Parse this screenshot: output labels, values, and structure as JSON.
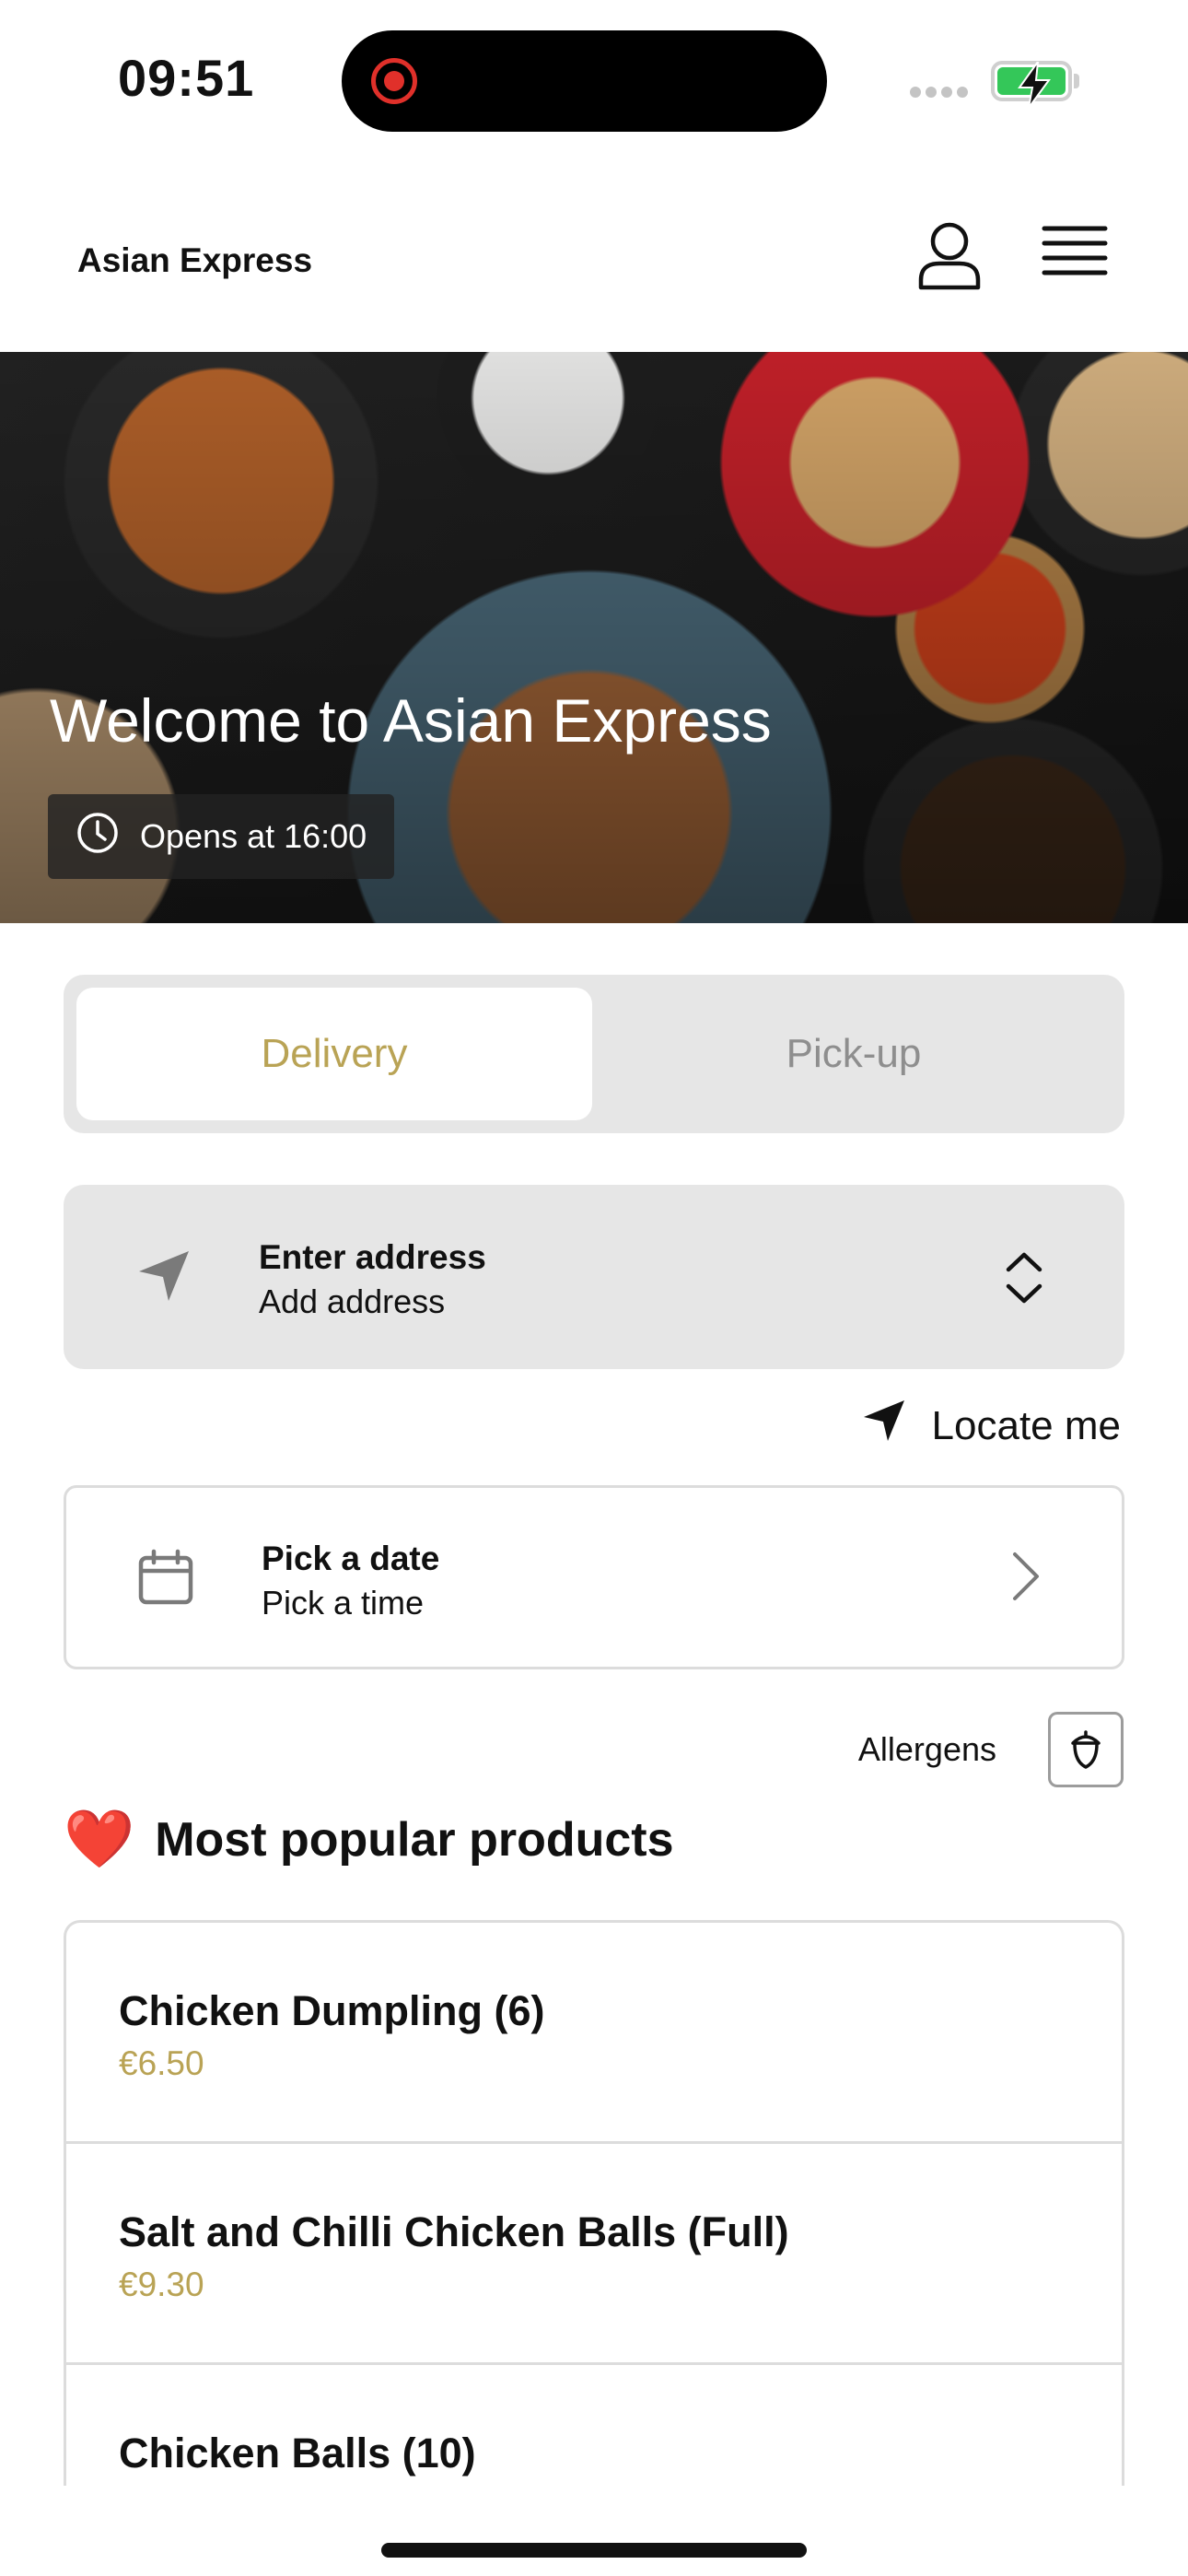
{
  "status_bar": {
    "time": "09:51",
    "recording_color": "#e0302a",
    "battery_color": "#34c759",
    "battery_icon": "battery-charging-icon"
  },
  "header": {
    "brand": "Asian Express",
    "profile_icon": "user-icon",
    "menu_icon": "hamburger-menu-icon"
  },
  "hero": {
    "title": "Welcome to Asian Express",
    "hours_badge": "Opens at 16:00",
    "hours_icon": "clock-icon"
  },
  "order_type": {
    "tabs": [
      {
        "label": "Delivery",
        "selected": true
      },
      {
        "label": "Pick-up",
        "selected": false
      }
    ],
    "accent_color": "#b9a355"
  },
  "address": {
    "title": "Enter address",
    "subtitle": "Add address",
    "icon": "navigation-arrow-icon"
  },
  "locate": {
    "label": "Locate me",
    "icon": "location-arrow-icon"
  },
  "schedule": {
    "title": "Pick a date",
    "subtitle": "Pick a time",
    "icon": "calendar-icon"
  },
  "allergens": {
    "label": "Allergens",
    "icon": "acorn-icon"
  },
  "popular": {
    "emoji": "❤️",
    "title": "Most popular products",
    "products": [
      {
        "name": "Chicken Dumpling (6)",
        "price": "€6.50"
      },
      {
        "name": "Salt and Chilli Chicken Balls (Full)",
        "price": "€9.30"
      },
      {
        "name": "Chicken Balls (10)",
        "price": ""
      }
    ]
  }
}
